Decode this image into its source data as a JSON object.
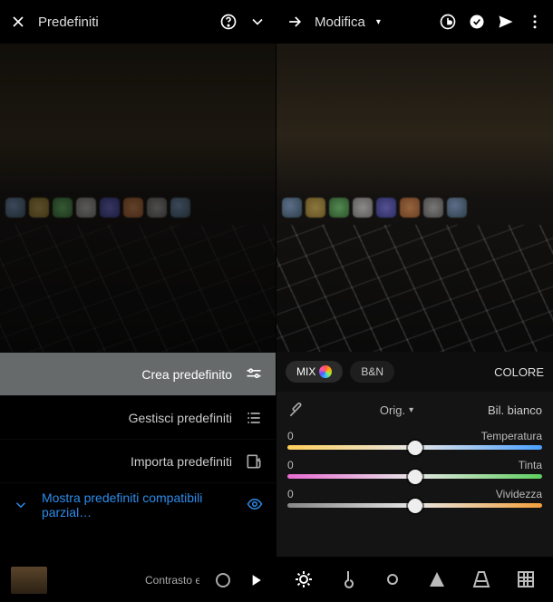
{
  "left": {
    "header": {
      "title": "Predefiniti"
    },
    "menu": {
      "create": "Crea predefinito",
      "manage": "Gestisci predefiniti",
      "import": "Importa predefiniti",
      "show_partial": "Mostra predefiniti compatibili parzial…"
    },
    "playbar": {
      "truncated": "Contrasto elev"
    }
  },
  "right": {
    "header": {
      "title": "Modifica"
    },
    "tabs": {
      "label": "COLORE",
      "bn": "B&N",
      "mix": "MIX"
    },
    "wb": {
      "label": "Bil. bianco",
      "value": "Orig."
    },
    "sliders": {
      "temperature": {
        "label": "Temperatura",
        "value": "0"
      },
      "tint": {
        "label": "Tinta",
        "value": "0"
      },
      "vibrance": {
        "label": "Vividezza",
        "value": "0"
      }
    }
  }
}
